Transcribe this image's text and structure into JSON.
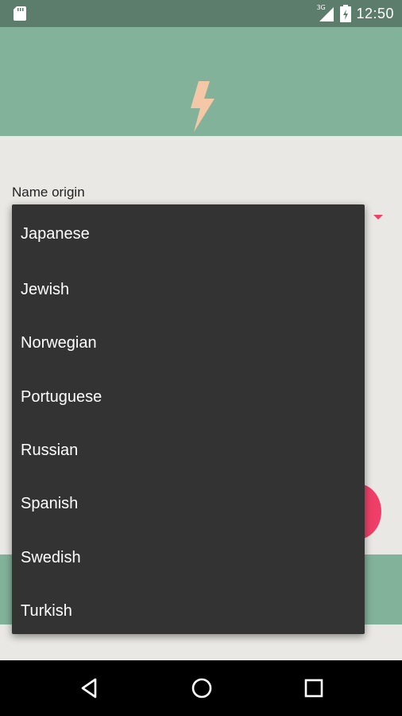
{
  "status_bar": {
    "time": "12:50",
    "network": "3G",
    "icons": [
      "sd-card-icon",
      "signal-icon",
      "battery-icon"
    ]
  },
  "header": {
    "logo_icon": "lightning-bolt-icon",
    "logo_color": "#f4c7a7",
    "background": "#83b29b"
  },
  "form": {
    "field_label": "Name origin"
  },
  "dropdown": {
    "options": [
      "Japanese",
      "Jewish",
      "Norwegian",
      "Portuguese",
      "Russian",
      "Spanish",
      "Swedish",
      "Turkish"
    ]
  },
  "accent_color": "#ef3f68",
  "nav_bar": {
    "buttons": [
      "back-icon",
      "home-icon",
      "recents-icon"
    ]
  }
}
